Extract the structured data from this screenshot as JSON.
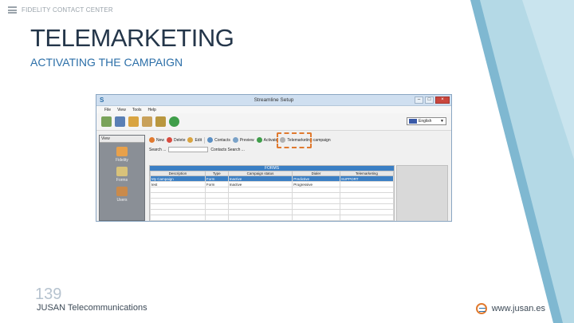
{
  "header": {
    "brand": "FIDELITY CONTACT CENTER"
  },
  "slide": {
    "title": "TELEMARKETING",
    "subtitle": "ACTIVATING THE CAMPAIGN",
    "page_number": "139",
    "company": "JUSAN Telecommunications",
    "website": "www.jusan.es"
  },
  "colors": {
    "accent_blue": "#2c6fa8",
    "accent_orange": "#e07a2f",
    "deco_light_blue": "#b4d9e6",
    "deco_blue": "#7fb8d1"
  },
  "window": {
    "title": "Streamline Setup",
    "app_icon": "S",
    "menu": [
      "File",
      "View",
      "Tools",
      "Help"
    ],
    "language": "English",
    "sidebar": {
      "header": "View",
      "items": [
        {
          "label": "Fidelity",
          "icon": "people-icon"
        },
        {
          "label": "Forms",
          "icon": "forms-icon"
        },
        {
          "label": "Users",
          "icon": "user-icon"
        }
      ]
    },
    "actions": {
      "new": "New",
      "delete": "Delete",
      "edit": "Edit",
      "contacts": "Contacts",
      "preview": "Preview",
      "activate": "Activate",
      "telemarketing": "Telemarketing campaign"
    },
    "search": {
      "label": "Search ...",
      "contacts_search": "Contacts Search ..."
    },
    "grid": {
      "band": "FORMS",
      "columns": [
        "Description",
        "Type",
        "Campaign status",
        "Dialer",
        "Telemarketing"
      ],
      "rows": [
        [
          "My Campaign",
          "Form",
          "Inactive",
          "Predictive",
          "SUPPORT"
        ],
        [
          "test",
          "Form",
          "Inactive",
          "Progressive",
          ""
        ]
      ]
    }
  }
}
